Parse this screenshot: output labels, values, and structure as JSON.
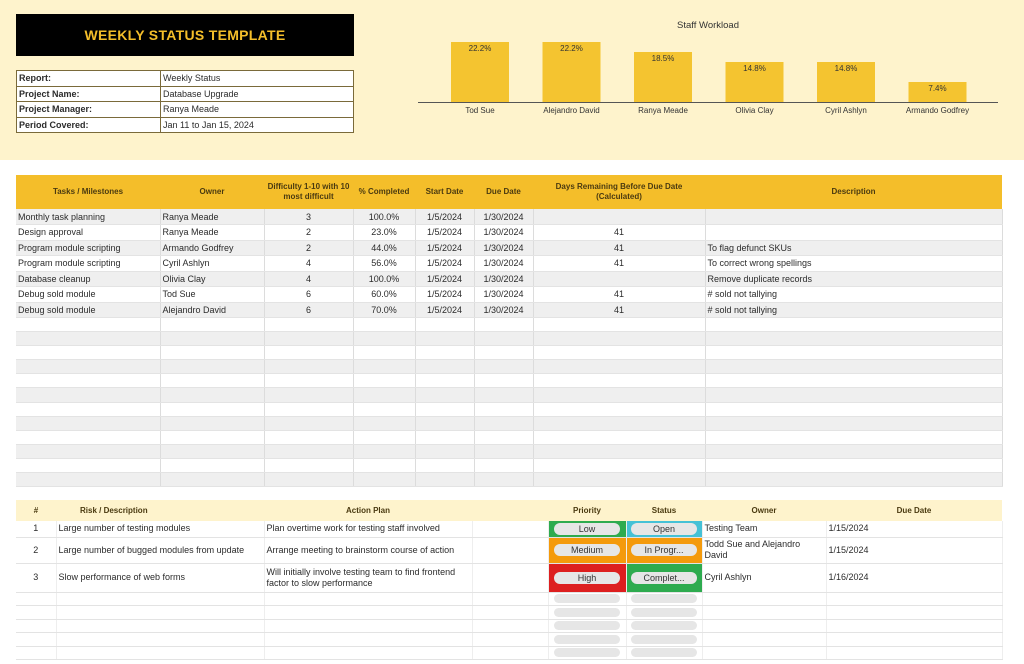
{
  "title": "WEEKLY STATUS TEMPLATE",
  "info": [
    {
      "key": "Report:",
      "value": "Weekly Status"
    },
    {
      "key": "Project Name:",
      "value": "Database Upgrade"
    },
    {
      "key": "Project Manager:",
      "value": "Ranya Meade"
    },
    {
      "key": "Period Covered:",
      "value": "Jan 11 to Jan 15, 2024"
    }
  ],
  "chart_data": {
    "type": "bar",
    "title": "Staff Workload",
    "categories": [
      "Tod Sue",
      "Alejandro David",
      "Ranya Meade",
      "Olivia Clay",
      "Cyril Ashlyn",
      "Armando Godfrey"
    ],
    "values": [
      22.2,
      22.2,
      18.5,
      14.8,
      14.8,
      7.4
    ],
    "labels": [
      "22.2%",
      "22.2%",
      "18.5%",
      "14.8%",
      "14.8%",
      "7.4%"
    ],
    "ylim": [
      0,
      22.2
    ],
    "color": "#f4c430",
    "grid": false,
    "legend": "none"
  },
  "tasks": {
    "headers": [
      "Tasks / Milestones",
      "Owner",
      "Difficulty 1-10 with 10 most difficult",
      "% Completed",
      "Start Date",
      "Due Date",
      "Days Remaining Before Due Date (Calculated)",
      "Description"
    ],
    "rows": [
      [
        "Monthly task planning",
        "Ranya Meade",
        "3",
        "100.0%",
        "1/5/2024",
        "1/30/2024",
        "",
        ""
      ],
      [
        "Design approval",
        "Ranya Meade",
        "2",
        "23.0%",
        "1/5/2024",
        "1/30/2024",
        "41",
        ""
      ],
      [
        "Program module scripting",
        "Armando Godfrey",
        "2",
        "44.0%",
        "1/5/2024",
        "1/30/2024",
        "41",
        "To flag defunct SKUs"
      ],
      [
        "Program module scripting",
        "Cyril Ashlyn",
        "4",
        "56.0%",
        "1/5/2024",
        "1/30/2024",
        "41",
        "To correct wrong spellings"
      ],
      [
        "Database cleanup",
        "Olivia Clay",
        "4",
        "100.0%",
        "1/5/2024",
        "1/30/2024",
        "",
        "Remove duplicate records"
      ],
      [
        "Debug sold module",
        "Tod Sue",
        "6",
        "60.0%",
        "1/5/2024",
        "1/30/2024",
        "41",
        "# sold not tallying"
      ],
      [
        "Debug sold module",
        "Alejandro David",
        "6",
        "70.0%",
        "1/5/2024",
        "1/30/2024",
        "41",
        "# sold not tallying"
      ]
    ],
    "empty_rows": 12
  },
  "risks": {
    "headers": [
      "#",
      "Risk / Description",
      "Action Plan",
      "Priority",
      "Status",
      "Owner",
      "Due Date"
    ],
    "rows": [
      {
        "num": "1",
        "risk": "Large number of testing modules",
        "plan": "Plan overtime work for testing staff involved",
        "priority": "Low",
        "priority_color": "#2eab4f",
        "status": "Open",
        "status_color": "#45c1d6",
        "owner": "Testing Team",
        "due": "1/15/2024"
      },
      {
        "num": "2",
        "risk": "Large number of bugged modules from update",
        "plan": "Arrange meeting to brainstorm course of action",
        "priority": "Medium",
        "priority_color": "#f49a0c",
        "status": "In Progr...",
        "status_color": "#f49a0c",
        "owner": "Todd Sue and Alejandro David",
        "due": "1/15/2024"
      },
      {
        "num": "3",
        "risk": "Slow performance of web forms",
        "plan": "Will initially involve testing team to find frontend factor to slow performance",
        "priority": "High",
        "priority_color": "#dd1f1f",
        "status": "Complet...",
        "status_color": "#2eab4f",
        "owner": "Cyril Ashlyn",
        "due": "1/16/2024"
      }
    ],
    "empty_rows": 5
  }
}
